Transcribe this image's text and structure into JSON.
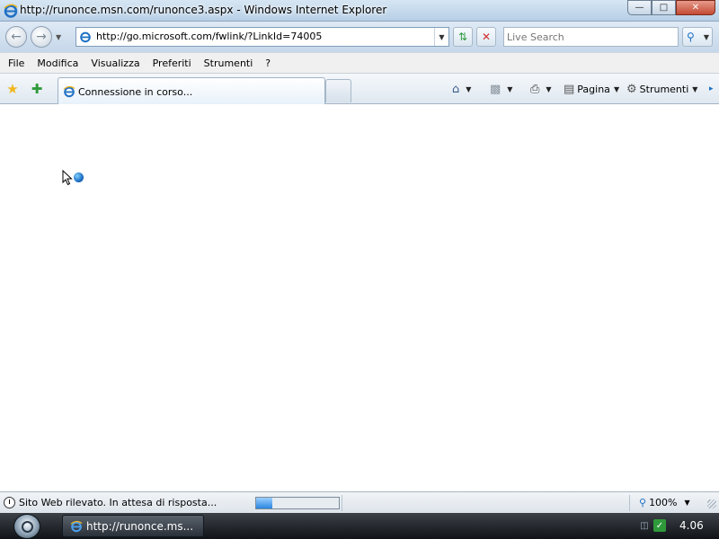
{
  "window": {
    "title": "http://runonce.msn.com/runonce3.aspx - Windows Internet Explorer",
    "buttons": {
      "minimize": "—",
      "maximize": "□",
      "close": "✕"
    }
  },
  "navigation": {
    "back_icon": "back-arrow-icon",
    "forward_icon": "forward-arrow-icon",
    "address_url": "http://go.microsoft.com/fwlink/?LinkId=74005",
    "search_placeholder": "Live Search"
  },
  "menu": {
    "items": [
      "File",
      "Modifica",
      "Visualizza",
      "Preferiti",
      "Strumenti",
      "?"
    ]
  },
  "tabs": {
    "active_label": "Connessione in corso..."
  },
  "command_bar": {
    "page_label": "Pagina",
    "tools_label": "Strumenti"
  },
  "status": {
    "text": "Sito Web rilevato. In attesa di risposta...",
    "progress_fraction": 0.2,
    "zoom": "100%"
  },
  "taskbar": {
    "window_button": "http://runonce.ms...",
    "clock": "4.06"
  },
  "colors": {
    "ie_blue": "#1d6fc4",
    "stop_red": "#d0302a",
    "refresh_green": "#2e9a3a",
    "star_yellow": "#f2b71d"
  }
}
